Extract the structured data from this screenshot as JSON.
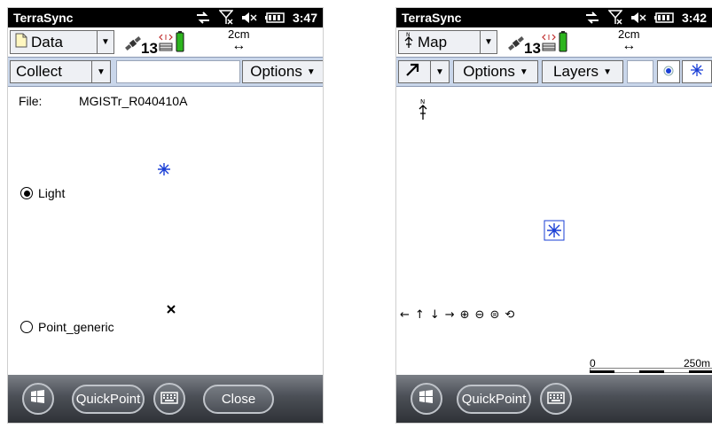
{
  "left": {
    "status": {
      "app": "TerraSync",
      "time": "3:47"
    },
    "toolbar": {
      "section": "Data",
      "sat_count": "13",
      "precision": "2cm"
    },
    "subbar": {
      "mode": "Collect",
      "options": "Options"
    },
    "file": {
      "label": "File:",
      "name": "MGISTr_R040410A"
    },
    "features": [
      {
        "label": "Light",
        "selected": true
      },
      {
        "label": "Point_generic",
        "selected": false
      }
    ],
    "bottom": {
      "quickpoint": "QuickPoint",
      "close": "Close"
    }
  },
  "right": {
    "status": {
      "app": "TerraSync",
      "time": "3:42"
    },
    "toolbar": {
      "section": "Map",
      "sat_count": "13",
      "precision": "2cm"
    },
    "subbar": {
      "options": "Options",
      "layers": "Layers"
    },
    "scale": {
      "start": "0",
      "end": "250m"
    },
    "bottom": {
      "quickpoint": "QuickPoint"
    }
  },
  "colors": {
    "accent_bar": "#c9d6ea",
    "position_marker": "#1a3fd6",
    "battery": "#2db51f"
  }
}
